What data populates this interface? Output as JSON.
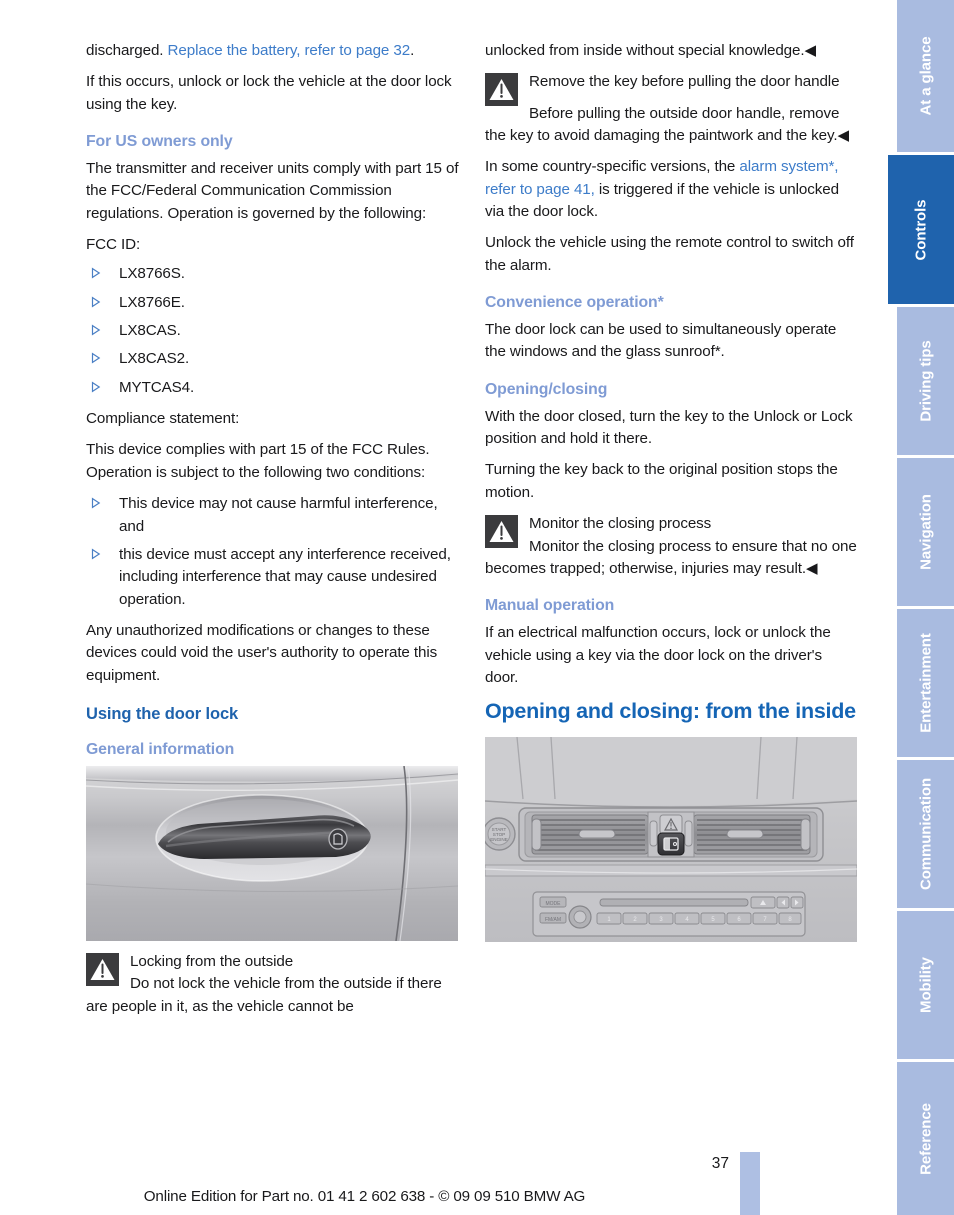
{
  "document": {
    "page_number": "37",
    "footer_note": "Online Edition for Part no. 01 41 2 602 638 - © 09 09 510 BMW AG"
  },
  "side_tabs": [
    {
      "label": "At a glance",
      "active": false
    },
    {
      "label": "Controls",
      "active": true
    },
    {
      "label": "Driving tips",
      "active": false
    },
    {
      "label": "Navigation",
      "active": false
    },
    {
      "label": "Entertainment",
      "active": false
    },
    {
      "label": "Communication",
      "active": false
    },
    {
      "label": "Mobility",
      "active": false
    },
    {
      "label": "Reference",
      "active": false
    }
  ],
  "left_column": {
    "para_discharged_pre": "discharged. ",
    "para_discharged_link": "Replace the battery, refer to page 32",
    "para_discharged_post": ".",
    "para_if_this_occurs": "If this occurs, unlock or lock the vehicle at the door lock using the key.",
    "heading_us_owners": "For US owners only",
    "para_transmitter": "The transmitter and receiver units comply with part 15 of the FCC/Federal Communication Commission regulations. Operation is governed by the following:",
    "label_fcc_id": "FCC ID:",
    "fcc_ids": [
      "LX8766S.",
      "LX8766E.",
      "LX8CAS.",
      "LX8CAS2.",
      "MYTCAS4."
    ],
    "label_compliance": "Compliance statement:",
    "para_complies": "This device complies with part 15 of the FCC Rules. Operation is subject to the following two conditions:",
    "conditions": [
      "This device may not cause harmful interference, and",
      "this device must accept any interference received, including interference that may cause undesired operation."
    ],
    "para_unauthorized": "Any unauthorized modifications or changes to these devices could void the user's authority to operate this equipment.",
    "heading_using_door_lock": "Using the door lock",
    "heading_general_info": "General information",
    "figure_door_handle_alt": "Exterior car door handle with key lock cover",
    "warning_locking_title": "Locking from the outside",
    "warning_locking_body": "Do not lock the vehicle from the outside if there are people in it, as the vehicle cannot be"
  },
  "right_column": {
    "para_unlocked_cont": "unlocked from inside without special knowledge.",
    "warning_remove_key_title": "Remove the key before pulling the door handle",
    "para_before_pulling": "Before pulling the outside door handle, remove the key to avoid damaging the paintwork and the key.",
    "para_alarm_pre": "In some country-specific versions, the ",
    "para_alarm_link": "alarm system*, refer to page 41,",
    "para_alarm_post": " is triggered if the vehicle is unlocked via the door lock.",
    "para_unlock_remote": "Unlock the vehicle using the remote control to switch off the alarm.",
    "heading_convenience": "Convenience operation*",
    "para_convenience": "The door lock can be used to simultaneously operate the windows and the glass sunroof*.",
    "heading_opening_closing": "Opening/closing",
    "para_with_door_closed": "With the door closed, turn the key to the Unlock or Lock position and hold it there.",
    "para_turning_back": "Turning the key back to the original position stops the motion.",
    "warning_monitor_title": "Monitor the closing process",
    "warning_monitor_body": "Monitor the closing process to ensure that no one becomes trapped; otherwise, injuries may result.",
    "heading_manual_operation": "Manual operation",
    "para_manual": "If an electrical malfunction occurs, lock or unlock the vehicle using a key via the door lock on the driver's door.",
    "heading_opening_inside": "Opening and closing: from the inside",
    "figure_dashboard_alt": "Center dashboard with vents, hazard warning button and central locking button"
  },
  "symbols": {
    "end_of_section": "◀",
    "bullet": "▷"
  },
  "colors": {
    "main_heading": "#1565b5",
    "section_heading": "#1f63ad",
    "sub_heading": "#7f9bd4",
    "link": "#3d7cc9",
    "tab_active": "#1f63ad",
    "tab_inactive": "#a9bbe0",
    "warning_icon_bg": "#3b3b3d",
    "footer_bar": "#aebfe3"
  }
}
